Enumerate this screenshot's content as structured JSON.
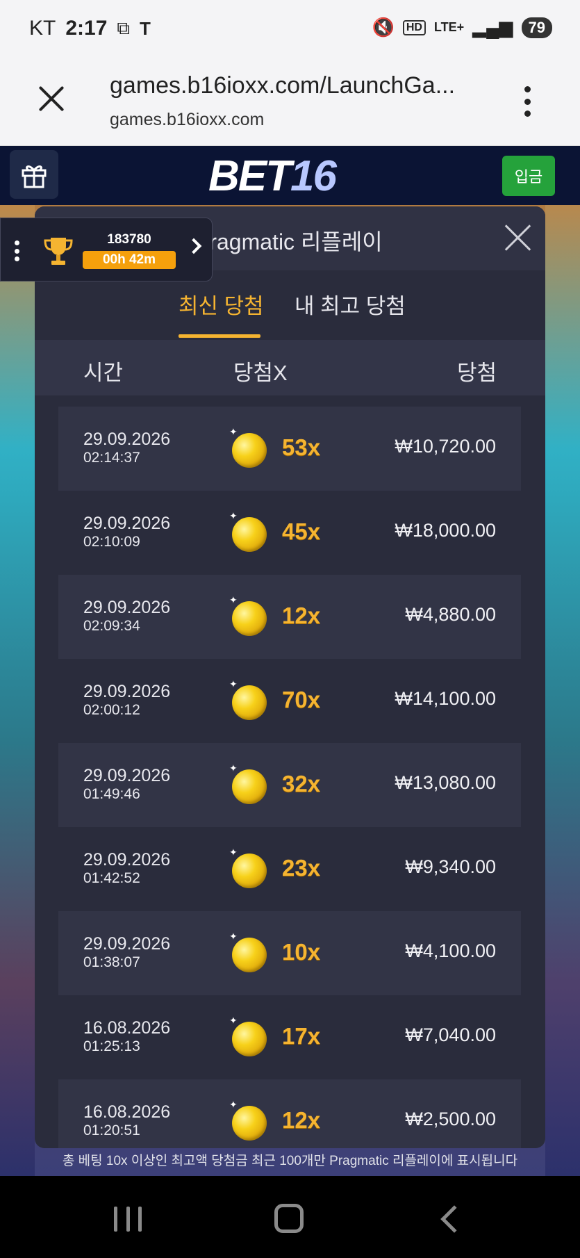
{
  "status_bar": {
    "carrier": "KT",
    "time": "2:17",
    "network": "LTE+",
    "battery": "79"
  },
  "browser": {
    "page_title": "games.b16ioxx.com/LaunchGa...",
    "domain": "games.b16ioxx.com"
  },
  "app_header": {
    "logo_text": "BET",
    "logo_num": "16",
    "deposit_label": "입금"
  },
  "leader_widget": {
    "score": "183780",
    "timer": "00h 42m"
  },
  "modal": {
    "title": "Pragmatic 리플레이",
    "tabs": [
      {
        "label": "최신 당첨",
        "active": true
      },
      {
        "label": "내 최고 당첨",
        "active": false
      }
    ],
    "columns": {
      "time": "시간",
      "multiplier": "당첨X",
      "win": "당첨"
    },
    "rows": [
      {
        "date": "29.09.2026",
        "time": "02:14:37",
        "multiplier": "53x",
        "win": "₩10,720.00"
      },
      {
        "date": "29.09.2026",
        "time": "02:10:09",
        "multiplier": "45x",
        "win": "₩18,000.00"
      },
      {
        "date": "29.09.2026",
        "time": "02:09:34",
        "multiplier": "12x",
        "win": "₩4,880.00"
      },
      {
        "date": "29.09.2026",
        "time": "02:00:12",
        "multiplier": "70x",
        "win": "₩14,100.00"
      },
      {
        "date": "29.09.2026",
        "time": "01:49:46",
        "multiplier": "32x",
        "win": "₩13,080.00"
      },
      {
        "date": "29.09.2026",
        "time": "01:42:52",
        "multiplier": "23x",
        "win": "₩9,340.00"
      },
      {
        "date": "29.09.2026",
        "time": "01:38:07",
        "multiplier": "10x",
        "win": "₩4,100.00"
      },
      {
        "date": "16.08.2026",
        "time": "01:25:13",
        "multiplier": "17x",
        "win": "₩7,040.00"
      },
      {
        "date": "16.08.2026",
        "time": "01:20:51",
        "multiplier": "12x",
        "win": "₩2,500.00"
      }
    ],
    "footer_note": "총 베팅 10x 이상인 최고액 당첨금 최근 100개만 Pragmatic 리플레이에 표시됩니다"
  },
  "colors": {
    "accent": "#f5b431",
    "modal_bg": "#2a2c3c",
    "deposit_green": "#25a23b",
    "header_navy": "#0b1434"
  }
}
